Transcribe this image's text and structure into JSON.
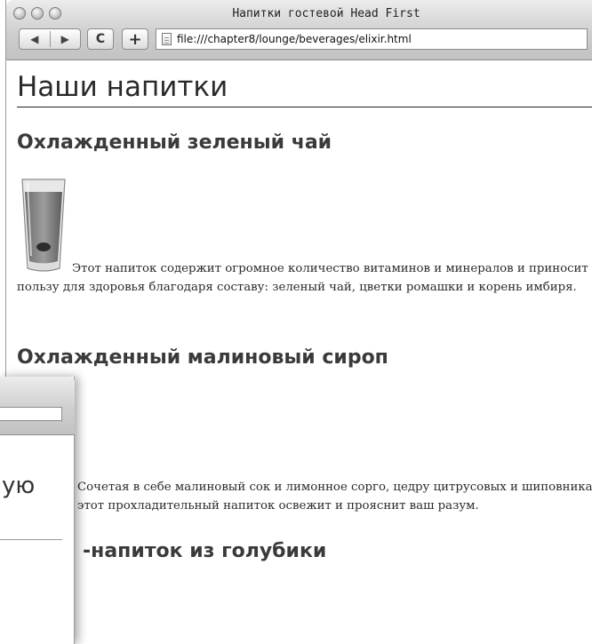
{
  "window": {
    "title": "Напитки гостевой Head First",
    "url": "file:///chapter8/lounge/beverages/elixir.html",
    "reload_label": "C",
    "add_label": "+",
    "back_label": "◀",
    "forward_label": "▶"
  },
  "page": {
    "title": "Наши напитки",
    "drinks": [
      {
        "heading": "Охлажденный зеленый чай",
        "text": "Этот напиток содержит огромное количество витаминов и минералов и приносит пользу для здоровья благодаря составу: зеленый чай, цветки ромашки и корень имбиря.",
        "icon": "glass-icon"
      },
      {
        "heading": "Охлажденный малиновый сироп",
        "text": "Сочетая в себе малиновый сок и лимонное сорго, цедру цитрусовых и шиповника, этот прохладительный напиток освежит и прояснит ваш разум."
      },
      {
        "heading": "-напиток из голубики"
      }
    ]
  },
  "window2": {
    "heading_fragment": "ую"
  }
}
